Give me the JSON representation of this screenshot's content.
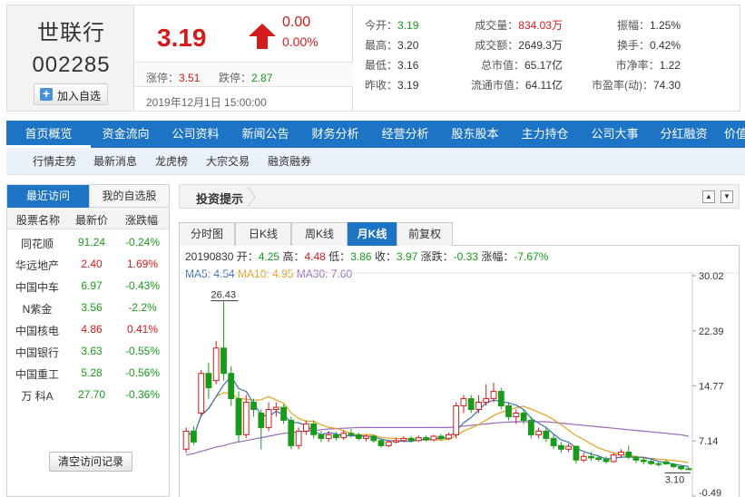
{
  "stock": {
    "name": "世联行",
    "code": "002285",
    "add_watch": "加入自选",
    "price": "3.19",
    "change": "0.00",
    "change_pct": "0.00%",
    "limit_up_label": "涨停：",
    "limit_up": "3.51",
    "limit_down_label": "跌停：",
    "limit_down": "2.87",
    "datetime": "2019年12月1日 15:00:00"
  },
  "stats": [
    {
      "label": "今开：",
      "value": "3.19",
      "color": "green"
    },
    {
      "label": "成交量：",
      "value": "834.03万",
      "color": "red"
    },
    {
      "label": "振幅：",
      "value": "1.25%",
      "color": "black"
    },
    {
      "label": "最高：",
      "value": "3.20",
      "color": "black"
    },
    {
      "label": "成交额：",
      "value": "2649.3万",
      "color": "black"
    },
    {
      "label": "换手：",
      "value": "0.42%",
      "color": "black"
    },
    {
      "label": "最低：",
      "value": "3.16",
      "color": "black"
    },
    {
      "label": "总市值：",
      "value": "65.17亿",
      "color": "black"
    },
    {
      "label": "市净率：",
      "value": "1.22",
      "color": "black"
    },
    {
      "label": "昨收：",
      "value": "3.19",
      "color": "black"
    },
    {
      "label": "流通市值：",
      "value": "64.11亿",
      "color": "black"
    },
    {
      "label": "市盈率(动)：",
      "value": "74.30",
      "color": "black"
    }
  ],
  "nav": {
    "items": [
      "首页概览",
      "资金流向",
      "公司资料",
      "新闻公告",
      "财务分析",
      "经营分析",
      "股东股本",
      "主力持仓",
      "公司大事",
      "分红融资",
      "价值"
    ],
    "active": 0
  },
  "subnav": [
    "行情走势",
    "最新消息",
    "龙虎榜",
    "大宗交易",
    "融资融券"
  ],
  "recent": {
    "tab_recent": "最近访问",
    "tab_watch": "我的自选股",
    "headers": [
      "股票名称",
      "最新价",
      "涨跌幅"
    ],
    "rows": [
      {
        "name": "同花顺",
        "price": "91.24",
        "pct": "-0.24%",
        "dir": "down"
      },
      {
        "name": "华远地产",
        "price": "2.40",
        "pct": "1.69%",
        "dir": "up"
      },
      {
        "name": "中国中车",
        "price": "6.97",
        "pct": "-0.43%",
        "dir": "down"
      },
      {
        "name": "N紫金",
        "price": "3.56",
        "pct": "-2.2%",
        "dir": "down"
      },
      {
        "name": "中国核电",
        "price": "4.86",
        "pct": "0.41%",
        "dir": "up"
      },
      {
        "name": "中国银行",
        "price": "3.63",
        "pct": "-0.55%",
        "dir": "down"
      },
      {
        "name": "中国重工",
        "price": "5.28",
        "pct": "-0.56%",
        "dir": "down"
      },
      {
        "name": "万 科A",
        "price": "27.70",
        "pct": "-0.36%",
        "dir": "down"
      }
    ],
    "clear": "清空访问记录"
  },
  "panel": {
    "title": "投资提示",
    "tabs": [
      "分时图",
      "日K线",
      "周K线",
      "月K线",
      "前复权"
    ],
    "active_tab": 3
  },
  "kline": {
    "date": "20190830",
    "open_label": "开：",
    "open": "4.25",
    "high_label": "高：",
    "high": "4.48",
    "low_label": "低：",
    "low": "3.86",
    "close_label": "收：",
    "close": "3.97",
    "chg_label": "涨跌：",
    "chg": "-0.33",
    "pct_label": "涨幅：",
    "pct": "-7.67%",
    "ma5_label": "MA5: ",
    "ma5": "4.54",
    "ma10_label": "MA10: ",
    "ma10": "4.95",
    "ma30_label": "MA30: ",
    "ma30": "7.60"
  },
  "chart_data": {
    "type": "candlestick",
    "y_ticks": [
      "30.02",
      "22.39",
      "14.77",
      "7.14",
      "-0.49"
    ],
    "ylim": [
      -0.49,
      30.02
    ],
    "max_label": "26.43",
    "min_label": "3.10",
    "colors": {
      "up": "#d31c1c",
      "down": "#1a9a1a",
      "ma5": "#3a6fb5",
      "ma10": "#e5a020",
      "ma30": "#9a6ab8"
    },
    "candles": [
      {
        "o": 6.0,
        "c": 8.5,
        "h": 9.0,
        "l": 5.5
      },
      {
        "o": 8.5,
        "c": 7.0,
        "h": 9.2,
        "l": 6.6
      },
      {
        "o": 11.0,
        "c": 16.5,
        "h": 17.0,
        "l": 10.5
      },
      {
        "o": 16.5,
        "c": 14.5,
        "h": 18.0,
        "l": 13.0
      },
      {
        "o": 15.5,
        "c": 20.0,
        "h": 21.0,
        "l": 15.0
      },
      {
        "o": 20.0,
        "c": 16.5,
        "h": 26.43,
        "l": 15.5
      },
      {
        "o": 16.5,
        "c": 13.0,
        "h": 17.5,
        "l": 12.0
      },
      {
        "o": 13.0,
        "c": 8.0,
        "h": 14.0,
        "l": 7.0
      },
      {
        "o": 8.0,
        "c": 12.5,
        "h": 13.5,
        "l": 7.5
      },
      {
        "o": 12.5,
        "c": 11.5,
        "h": 13.0,
        "l": 10.5
      },
      {
        "o": 11.0,
        "c": 9.0,
        "h": 11.5,
        "l": 6.0
      },
      {
        "o": 9.0,
        "c": 11.5,
        "h": 12.5,
        "l": 8.5
      },
      {
        "o": 11.5,
        "c": 11.8,
        "h": 12.5,
        "l": 10.5
      },
      {
        "o": 11.8,
        "c": 10.0,
        "h": 12.2,
        "l": 9.5
      },
      {
        "o": 10.0,
        "c": 6.5,
        "h": 10.5,
        "l": 6.0
      },
      {
        "o": 6.5,
        "c": 8.5,
        "h": 9.0,
        "l": 6.0
      },
      {
        "o": 8.5,
        "c": 9.5,
        "h": 10.0,
        "l": 8.0
      },
      {
        "o": 9.5,
        "c": 8.0,
        "h": 10.0,
        "l": 7.5
      },
      {
        "o": 8.0,
        "c": 7.5,
        "h": 8.5,
        "l": 7.0
      },
      {
        "o": 7.5,
        "c": 8.0,
        "h": 8.5,
        "l": 7.0
      },
      {
        "o": 8.0,
        "c": 7.6,
        "h": 8.4,
        "l": 7.2
      },
      {
        "o": 7.6,
        "c": 8.2,
        "h": 8.6,
        "l": 7.3
      },
      {
        "o": 8.2,
        "c": 8.0,
        "h": 8.8,
        "l": 7.6
      },
      {
        "o": 8.0,
        "c": 7.5,
        "h": 8.3,
        "l": 7.2
      },
      {
        "o": 7.5,
        "c": 7.8,
        "h": 8.0,
        "l": 7.1
      },
      {
        "o": 7.8,
        "c": 7.2,
        "h": 8.0,
        "l": 6.9
      },
      {
        "o": 7.2,
        "c": 6.5,
        "h": 7.5,
        "l": 6.2
      },
      {
        "o": 6.5,
        "c": 7.0,
        "h": 7.3,
        "l": 6.3
      },
      {
        "o": 7.0,
        "c": 7.2,
        "h": 7.6,
        "l": 6.8
      },
      {
        "o": 7.2,
        "c": 7.5,
        "h": 7.8,
        "l": 7.0
      },
      {
        "o": 7.5,
        "c": 7.2,
        "h": 7.8,
        "l": 6.9
      },
      {
        "o": 7.2,
        "c": 7.6,
        "h": 7.9,
        "l": 7.0
      },
      {
        "o": 7.6,
        "c": 7.3,
        "h": 7.9,
        "l": 7.1
      },
      {
        "o": 7.3,
        "c": 7.8,
        "h": 8.0,
        "l": 7.1
      },
      {
        "o": 7.8,
        "c": 7.5,
        "h": 8.1,
        "l": 7.2
      },
      {
        "o": 7.5,
        "c": 8.0,
        "h": 8.3,
        "l": 7.3
      },
      {
        "o": 8.0,
        "c": 12.0,
        "h": 12.5,
        "l": 7.5
      },
      {
        "o": 12.0,
        "c": 13.0,
        "h": 13.5,
        "l": 11.0
      },
      {
        "o": 13.0,
        "c": 11.5,
        "h": 13.5,
        "l": 11.0
      },
      {
        "o": 11.5,
        "c": 12.5,
        "h": 13.5,
        "l": 11.0
      },
      {
        "o": 12.5,
        "c": 13.0,
        "h": 15.0,
        "l": 12.0
      },
      {
        "o": 13.0,
        "c": 14.0,
        "h": 15.2,
        "l": 12.5
      },
      {
        "o": 14.0,
        "c": 12.0,
        "h": 14.5,
        "l": 11.5
      },
      {
        "o": 12.0,
        "c": 10.5,
        "h": 12.5,
        "l": 10.0
      },
      {
        "o": 10.5,
        "c": 11.0,
        "h": 11.5,
        "l": 9.5
      },
      {
        "o": 11.0,
        "c": 10.0,
        "h": 11.5,
        "l": 9.5
      },
      {
        "o": 10.0,
        "c": 8.0,
        "h": 10.5,
        "l": 7.5
      },
      {
        "o": 8.0,
        "c": 8.5,
        "h": 9.0,
        "l": 7.5
      },
      {
        "o": 8.5,
        "c": 7.5,
        "h": 9.0,
        "l": 7.0
      },
      {
        "o": 7.5,
        "c": 6.5,
        "h": 8.0,
        "l": 6.0
      },
      {
        "o": 6.5,
        "c": 6.0,
        "h": 7.0,
        "l": 5.5
      },
      {
        "o": 6.0,
        "c": 6.4,
        "h": 6.8,
        "l": 5.6
      },
      {
        "o": 6.4,
        "c": 4.5,
        "h": 6.5,
        "l": 4.0
      },
      {
        "o": 4.5,
        "c": 5.0,
        "h": 5.5,
        "l": 4.2
      },
      {
        "o": 5.0,
        "c": 4.8,
        "h": 5.6,
        "l": 4.4
      },
      {
        "o": 4.8,
        "c": 4.6,
        "h": 5.2,
        "l": 4.3
      },
      {
        "o": 4.6,
        "c": 4.3,
        "h": 5.0,
        "l": 4.0
      },
      {
        "o": 4.3,
        "c": 5.2,
        "h": 5.5,
        "l": 4.1
      },
      {
        "o": 5.2,
        "c": 5.6,
        "h": 6.0,
        "l": 4.9
      },
      {
        "o": 5.6,
        "c": 4.9,
        "h": 6.5,
        "l": 4.6
      },
      {
        "o": 4.9,
        "c": 4.5,
        "h": 5.1,
        "l": 4.1
      },
      {
        "o": 4.5,
        "c": 4.3,
        "h": 4.8,
        "l": 3.9
      },
      {
        "o": 4.3,
        "c": 4.0,
        "h": 4.6,
        "l": 3.8
      },
      {
        "o": 4.0,
        "c": 3.9,
        "h": 4.3,
        "l": 3.6
      },
      {
        "o": 4.25,
        "c": 3.97,
        "h": 4.48,
        "l": 3.86
      },
      {
        "o": 3.9,
        "c": 3.6,
        "h": 4.1,
        "l": 3.4
      },
      {
        "o": 3.6,
        "c": 3.3,
        "h": 3.8,
        "l": 3.1
      },
      {
        "o": 3.3,
        "c": 3.19,
        "h": 3.5,
        "l": 3.1
      }
    ],
    "ma30": [
      5.2,
      5.4,
      5.7,
      6.0,
      6.3,
      6.5,
      6.8,
      7.0,
      7.2,
      7.4,
      7.6,
      7.8,
      8.0,
      8.2,
      8.3,
      8.4,
      8.5,
      8.6,
      8.7,
      8.8,
      8.85,
      8.9,
      8.95,
      9.0,
      9.0,
      9.0,
      9.0,
      9.0,
      9.0,
      9.0,
      9.0,
      9.0,
      9.0,
      9.0,
      9.0,
      9.0,
      9.1,
      9.2,
      9.3,
      9.4,
      9.5,
      9.6,
      9.7,
      9.75,
      9.8,
      9.8,
      9.8,
      9.8,
      9.8,
      9.7,
      9.6,
      9.5,
      9.4,
      9.3,
      9.2,
      9.1,
      9.0,
      8.9,
      8.8,
      8.7,
      8.6,
      8.5,
      8.4,
      8.3,
      8.2,
      8.1,
      8.0,
      7.8
    ]
  }
}
